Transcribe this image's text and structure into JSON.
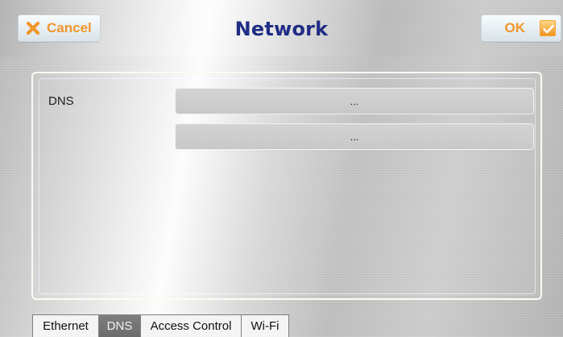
{
  "header": {
    "title": "Network",
    "cancel_label": "Cancel",
    "ok_label": "OK"
  },
  "icons": {
    "cancel": "close-icon",
    "ok": "check-icon"
  },
  "content": {
    "dns_label": "DNS",
    "fields": [
      {
        "value": "..."
      },
      {
        "value": "..."
      }
    ]
  },
  "tabs": [
    {
      "label": "Ethernet"
    },
    {
      "label": "DNS"
    },
    {
      "label": "Access Control"
    },
    {
      "label": "Wi-Fi"
    }
  ],
  "colors": {
    "title": "#1f2d85",
    "accent": "#f0962b",
    "active_tab": "#6f6f6f"
  }
}
